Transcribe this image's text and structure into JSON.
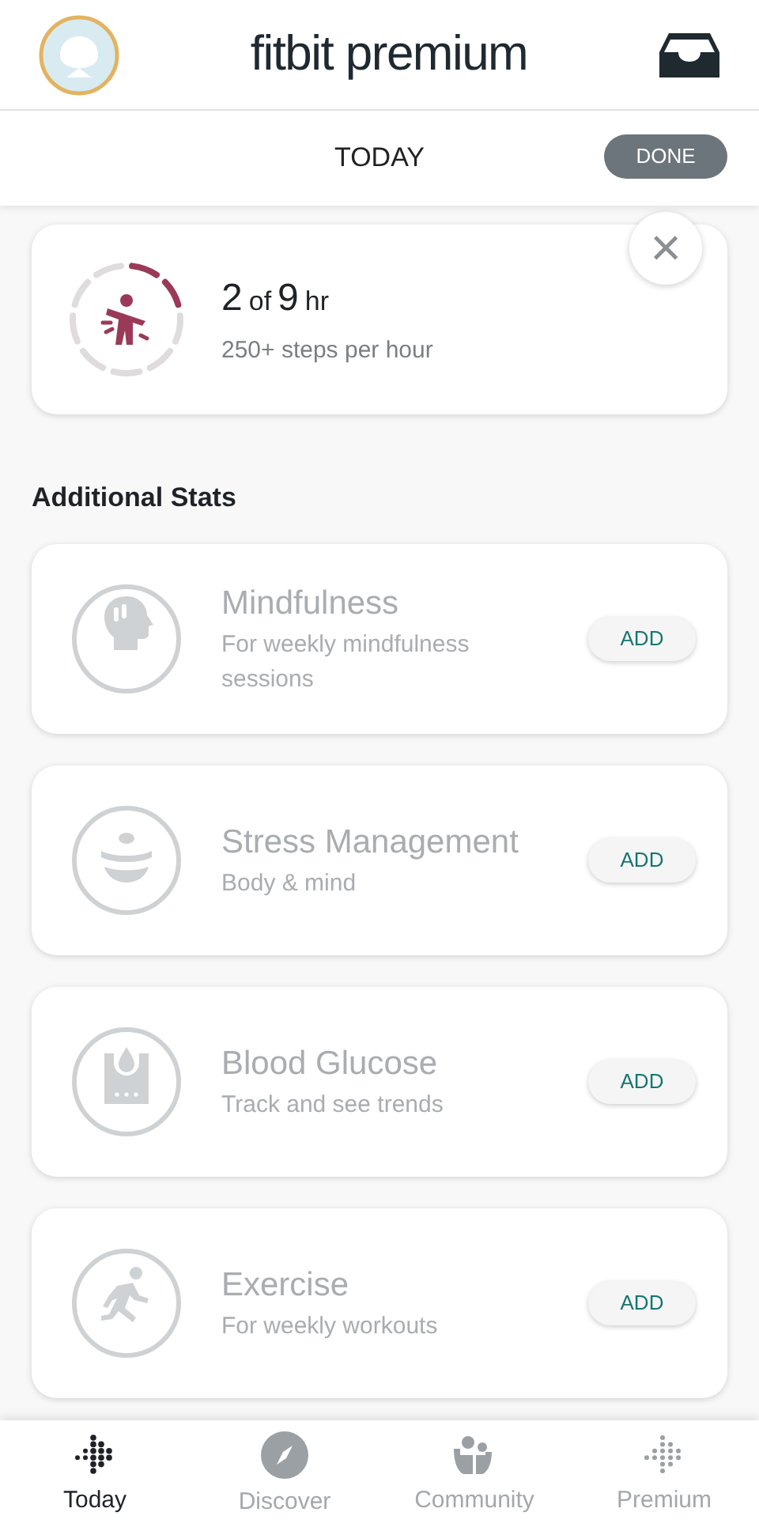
{
  "header": {
    "title": "fitbit premium"
  },
  "subbar": {
    "title": "TODAY",
    "done_button": "DONE"
  },
  "hourly_card": {
    "value": "2",
    "of": "of",
    "total": "9",
    "unit": "hr",
    "subtitle": "250+ steps per hour",
    "close_label": "×"
  },
  "section_title": "Additional Stats",
  "stats": [
    {
      "kind": "mind",
      "title": "Mindfulness",
      "subtitle": "For weekly mindfulness sessions",
      "button": "ADD",
      "enabled": false
    },
    {
      "kind": "stress",
      "title": "Stress Management",
      "subtitle": "Body & mind",
      "button": "ADD",
      "enabled": false
    },
    {
      "kind": "glucose",
      "title": "Blood Glucose",
      "subtitle": "Track and see trends",
      "button": "ADD",
      "enabled": false
    },
    {
      "kind": "exercise",
      "title": "Exercise",
      "subtitle": "For weekly workouts",
      "button": "ADD",
      "enabled": false
    }
  ],
  "nav": [
    {
      "kind": "today",
      "label": "Today",
      "selected": true
    },
    {
      "kind": "discover",
      "label": "Discover",
      "selected": false
    },
    {
      "kind": "community",
      "label": "Community",
      "selected": false
    },
    {
      "kind": "premium",
      "label": "Premium",
      "selected": false
    }
  ]
}
